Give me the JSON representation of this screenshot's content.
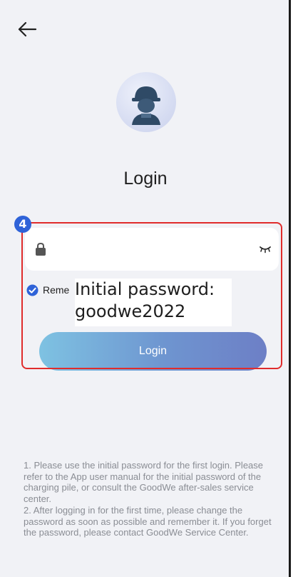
{
  "screen": {
    "title": "Login",
    "back_icon": "arrow-left-icon",
    "avatar_icon": "worker-avatar-icon"
  },
  "annotation": {
    "step_number": "4",
    "highlight_color": "#e02c2c",
    "badge_color": "#2f63d8",
    "note_line1": "Initial password:",
    "note_line2": "goodwe2022"
  },
  "password_field": {
    "value": "",
    "lock_icon": "lock-icon",
    "visibility_icon": "eye-closed-icon"
  },
  "remember": {
    "label": "Reme",
    "checked": true,
    "check_color": "#2f63d8"
  },
  "login_button": {
    "label": "Login"
  },
  "tips": {
    "text": "1. Please use the initial password for the first login. Please refer to the App user manual for the initial password of the charging pile, or consult the GoodWe after-sales service center.\n2. After logging in for the first time, please change the password as soon as possible and remember it. If you forget the password, please contact GoodWe Service Center."
  }
}
